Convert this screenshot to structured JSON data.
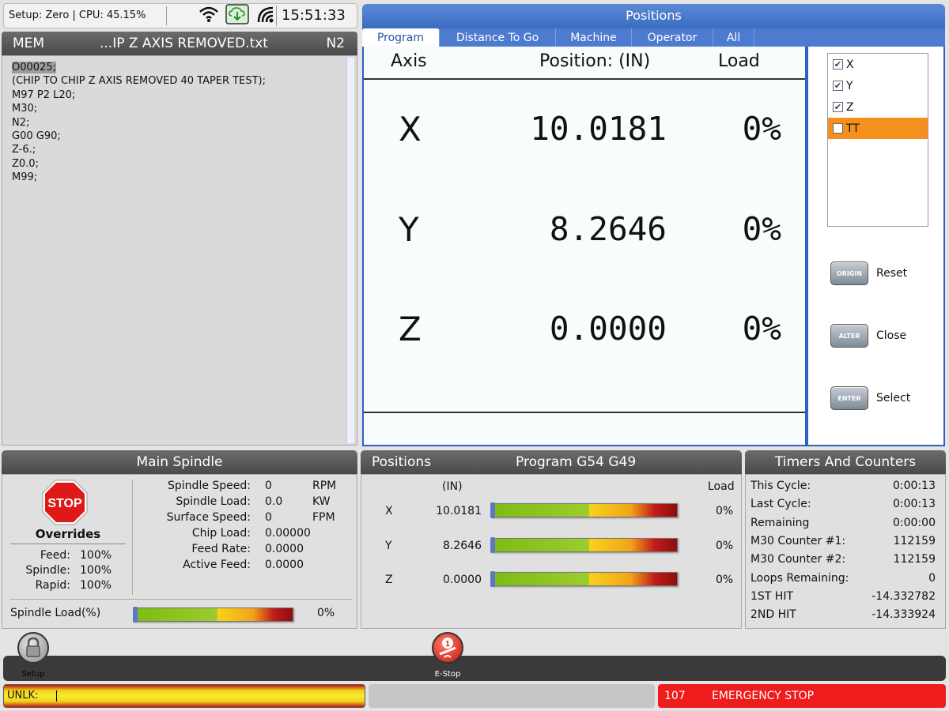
{
  "status": {
    "setup_text": "Setup: Zero | CPU: 45.15%",
    "clock": "15:51:33",
    "icons": [
      "wifi-icon",
      "cloud-download-icon",
      "network-share-icon"
    ]
  },
  "program": {
    "mode": "MEM",
    "filename": "...IP Z AXIS REMOVED.txt",
    "block": "N2",
    "lines": [
      "O00025;",
      "(CHIP TO CHIP Z AXIS REMOVED 40 TAPER TEST);",
      "M97 P2 L20;",
      "M30;",
      "N2;",
      "G00 G90;",
      "Z-6.;",
      "Z0.0;",
      "M99;"
    ]
  },
  "positions": {
    "title": "Positions",
    "tabs": [
      "Program",
      "Distance To Go",
      "Machine",
      "Operator",
      "All"
    ],
    "active_tab": "Program",
    "col_axis": "Axis",
    "col_position": "Position:  (IN)",
    "col_load": "Load",
    "rows": [
      {
        "axis": "X",
        "value": "10.0181",
        "load": "0%"
      },
      {
        "axis": "Y",
        "value": "8.2646",
        "load": "0%"
      },
      {
        "axis": "Z",
        "value": "0.0000",
        "load": "0%"
      }
    ],
    "axis_list": [
      {
        "label": "X",
        "checked": true
      },
      {
        "label": "Y",
        "checked": true
      },
      {
        "label": "Z",
        "checked": true
      },
      {
        "label": "TT",
        "checked": false
      }
    ],
    "keys": [
      {
        "key": "ORIGIN",
        "label": "Reset"
      },
      {
        "key": "ALTER",
        "label": "Close"
      },
      {
        "key": "ENTER",
        "label": "Select"
      }
    ]
  },
  "spindle": {
    "title": "Main Spindle",
    "stop_label": "STOP",
    "overrides_label": "Overrides",
    "overrides": [
      {
        "name": "Feed:",
        "value": "100%"
      },
      {
        "name": "Spindle:",
        "value": "100%"
      },
      {
        "name": "Rapid:",
        "value": "100%"
      }
    ],
    "params": [
      {
        "name": "Spindle Speed:",
        "value": "0",
        "unit": "RPM"
      },
      {
        "name": "Spindle Load:",
        "value": "0.0",
        "unit": "KW"
      },
      {
        "name": "Surface Speed:",
        "value": "0",
        "unit": "FPM"
      },
      {
        "name": "Chip Load:",
        "value": "0.00000",
        "unit": ""
      },
      {
        "name": "Feed Rate:",
        "value": "0.0000",
        "unit": ""
      },
      {
        "name": "Active Feed:",
        "value": "0.0000",
        "unit": ""
      }
    ],
    "load_label": "Spindle Load(%)",
    "load_value": "0%",
    "load_fraction": 0
  },
  "positions_mini": {
    "title": "Positions",
    "subtitle": "Program G54 G49",
    "unit": "(IN)",
    "load_header": "Load",
    "rows": [
      {
        "axis": "X",
        "value": "10.0181",
        "load": "0%",
        "fraction": 0
      },
      {
        "axis": "Y",
        "value": "8.2646",
        "load": "0%",
        "fraction": 0
      },
      {
        "axis": "Z",
        "value": "0.0000",
        "load": "0%",
        "fraction": 0
      }
    ]
  },
  "timers": {
    "title": "Timers And Counters",
    "rows": [
      {
        "name": "This Cycle:",
        "value": "0:00:13"
      },
      {
        "name": "Last Cycle:",
        "value": "0:00:13"
      },
      {
        "name": "Remaining",
        "value": "0:00:00"
      },
      {
        "name": "M30 Counter #1:",
        "value": "112159"
      },
      {
        "name": "M30 Counter #2:",
        "value": "112159"
      },
      {
        "name": "Loops Remaining:",
        "value": "0"
      },
      {
        "name": "1ST HIT",
        "value": "-14.332782"
      },
      {
        "name": "2ND HIT",
        "value": "-14.333924"
      }
    ]
  },
  "toolbar": {
    "setup_label": "Setup",
    "estop_label": "E-Stop"
  },
  "alarm_strip": {
    "unlk_text": "UNLK:",
    "alarm_code": "107",
    "alarm_text": "EMERGENCY STOP"
  },
  "colors": {
    "accent_blue": "#3c6cc0",
    "highlight_orange": "#f5901e",
    "alarm_red": "#ee1c1c"
  }
}
